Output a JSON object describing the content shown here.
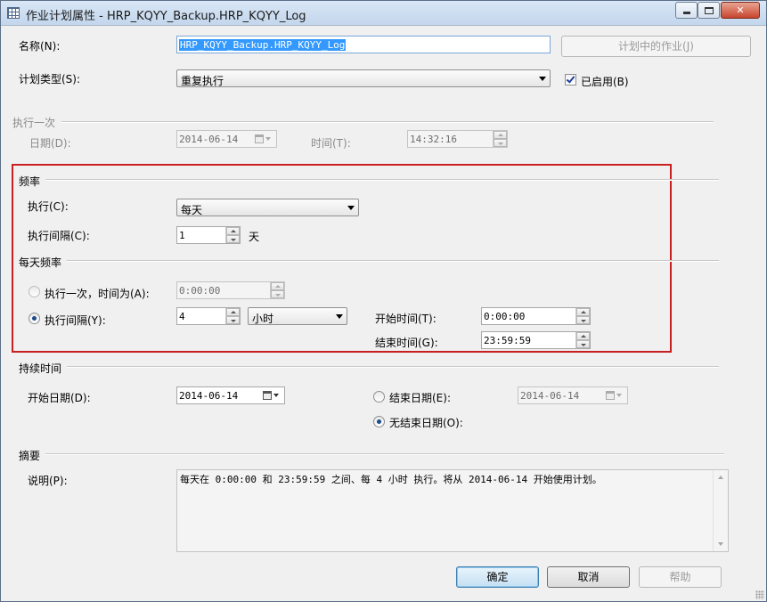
{
  "window": {
    "title": "作业计划属性 - HRP_KQYY_Backup.HRP_KQYY_Log"
  },
  "name_row": {
    "label": "名称(N):",
    "value": "HRP_KQYY_Backup.HRP_KQYY_Log",
    "jobs_button": "计划中的作业(J)"
  },
  "schedule_type": {
    "label": "计划类型(S):",
    "value": "重复执行",
    "enabled_label": "已启用(B)",
    "enabled": true
  },
  "one_time": {
    "section": "执行一次",
    "date_label": "日期(D):",
    "date_value": "2014-06-14",
    "time_label": "时间(T):",
    "time_value": "14:32:16"
  },
  "frequency": {
    "section": "频率",
    "occurs_label": "执行(C):",
    "occurs_value": "每天",
    "recurs_label": "执行间隔(C):",
    "recurs_value": "1",
    "recurs_unit": "天"
  },
  "daily_frequency": {
    "section": "每天频率",
    "once_label": "执行一次，时间为(A):",
    "once_value": "0:00:00",
    "every_label": "执行间隔(Y):",
    "every_value": "4",
    "every_unit": "小时",
    "start_label": "开始时间(T):",
    "start_value": "0:00:00",
    "end_label": "结束时间(G):",
    "end_value": "23:59:59",
    "selected": "every"
  },
  "duration": {
    "section": "持续时间",
    "start_label": "开始日期(D):",
    "start_value": "2014-06-14",
    "end_label": "结束日期(E):",
    "end_value": "2014-06-14",
    "no_end_label": "无结束日期(O):",
    "selected": "no_end"
  },
  "summary": {
    "section": "摘要",
    "desc_label": "说明(P):",
    "desc_value": "每天在 0:00:00 和 23:59:59 之间、每 4 小时 执行。将从 2014-06-14 开始使用计划。"
  },
  "buttons": {
    "ok": "确定",
    "cancel": "取消",
    "help": "帮助"
  },
  "colors": {
    "highlight_border": "#c82020",
    "selection": "#3399ff"
  }
}
